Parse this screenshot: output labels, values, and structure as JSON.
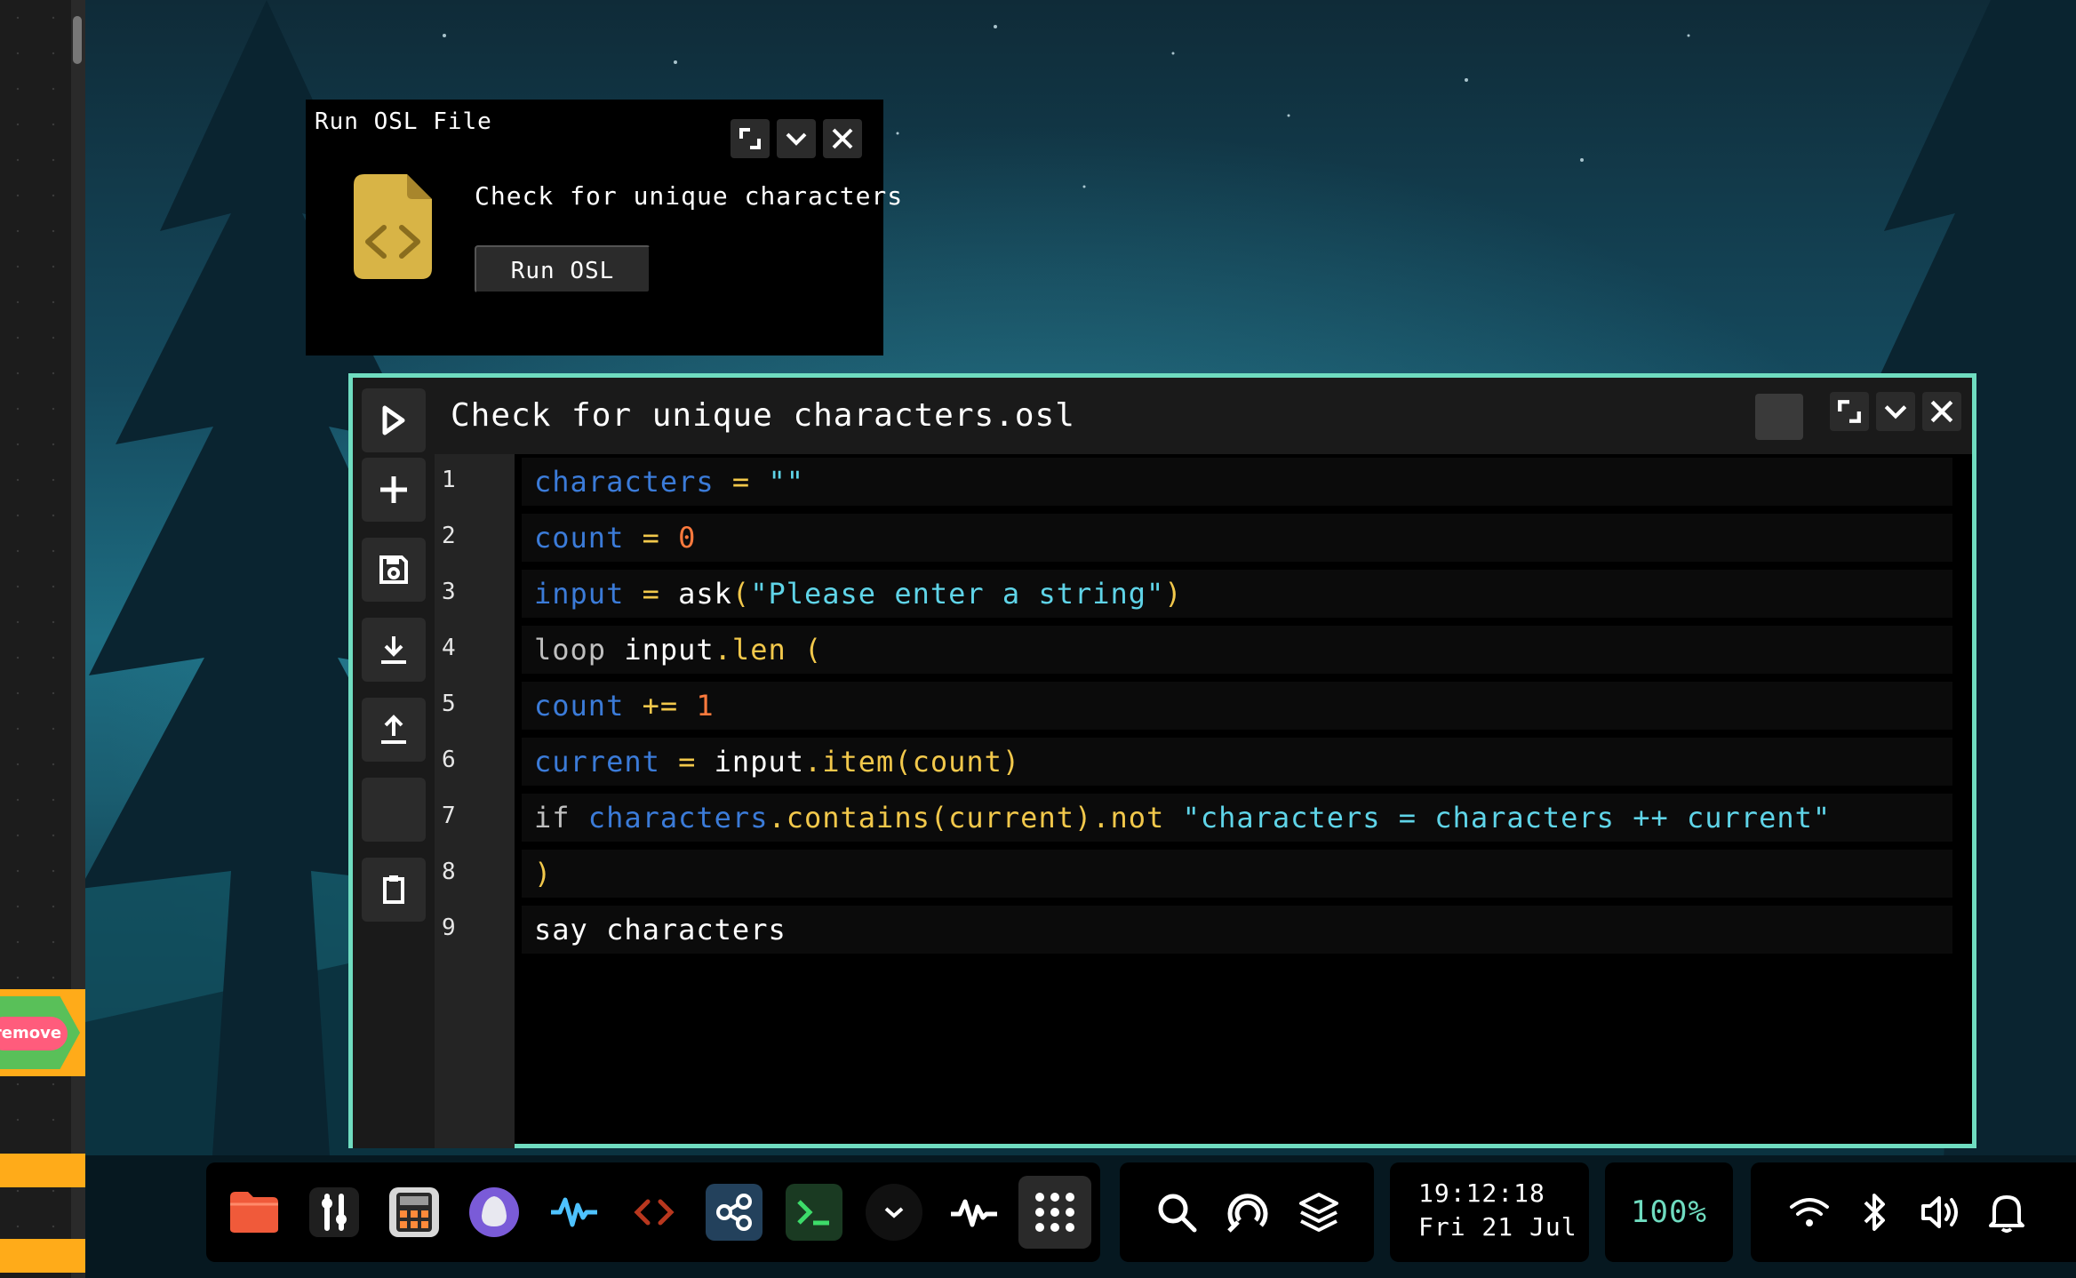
{
  "sidebar": {
    "remove_block_label": "remove"
  },
  "run_window": {
    "title": "Run OSL File",
    "file_label": "Check for unique characters",
    "run_button": "Run OSL",
    "file_icon": "code-file-icon"
  },
  "editor": {
    "title": "Check for unique characters.osl",
    "line_numbers": [
      "1",
      "2",
      "3",
      "4",
      "5",
      "6",
      "7",
      "8",
      "9"
    ],
    "tools": [
      "play-icon",
      "plus-icon",
      "save-icon",
      "download-icon",
      "upload-icon",
      "blank",
      "clipboard-icon"
    ],
    "code": [
      [
        {
          "t": "characters",
          "c": "var"
        },
        {
          "t": " = ",
          "c": "op"
        },
        {
          "t": "\"\"",
          "c": "str"
        }
      ],
      [
        {
          "t": "count",
          "c": "var"
        },
        {
          "t": " = ",
          "c": "op"
        },
        {
          "t": "0",
          "c": "num"
        }
      ],
      [
        {
          "t": "input",
          "c": "var"
        },
        {
          "t": " = ",
          "c": "op"
        },
        {
          "t": "ask",
          "c": "fn"
        },
        {
          "t": "(",
          "c": "op"
        },
        {
          "t": "\"Please enter a string\"",
          "c": "str"
        },
        {
          "t": ")",
          "c": "op"
        }
      ],
      [
        {
          "t": "loop ",
          "c": "kw"
        },
        {
          "t": "input",
          "c": "fn"
        },
        {
          "t": ".len",
          "c": "meth"
        },
        {
          "t": " (",
          "c": "op"
        }
      ],
      [
        {
          "t": "count",
          "c": "var"
        },
        {
          "t": " += ",
          "c": "op"
        },
        {
          "t": "1",
          "c": "num"
        }
      ],
      [
        {
          "t": "current",
          "c": "var"
        },
        {
          "t": " = ",
          "c": "op"
        },
        {
          "t": "input",
          "c": "fn"
        },
        {
          "t": ".item(count)",
          "c": "meth"
        }
      ],
      [
        {
          "t": "if ",
          "c": "kw"
        },
        {
          "t": "characters",
          "c": "var"
        },
        {
          "t": ".contains(current).not ",
          "c": "meth"
        },
        {
          "t": "\"characters = characters ++ current\"",
          "c": "str"
        }
      ],
      [
        {
          "t": ")",
          "c": "op"
        }
      ],
      [
        {
          "t": "say characters",
          "c": "fn"
        }
      ]
    ]
  },
  "taskbar": {
    "apps": [
      "folder-icon",
      "tweaks-icon",
      "calculator-icon",
      "penguin-icon",
      "waveform-icon",
      "code-icon",
      "share-icon",
      "terminal-icon",
      "chevron-icon",
      "activity-icon",
      "apps-grid-icon"
    ],
    "tools": [
      "search-icon",
      "refresh-icon",
      "layers-icon"
    ],
    "clock_time": "19:12:18",
    "clock_date": "Fri 21 Jul",
    "battery": "100%",
    "status": [
      "wifi-icon",
      "bluetooth-icon",
      "speaker-icon",
      "bell-icon"
    ]
  },
  "colors": {
    "accent": "#6fdcc0",
    "code_var": "#3b7bd8",
    "code_op": "#f2c84b",
    "code_num": "#ff7a3d",
    "code_str": "#5fd4e8"
  }
}
